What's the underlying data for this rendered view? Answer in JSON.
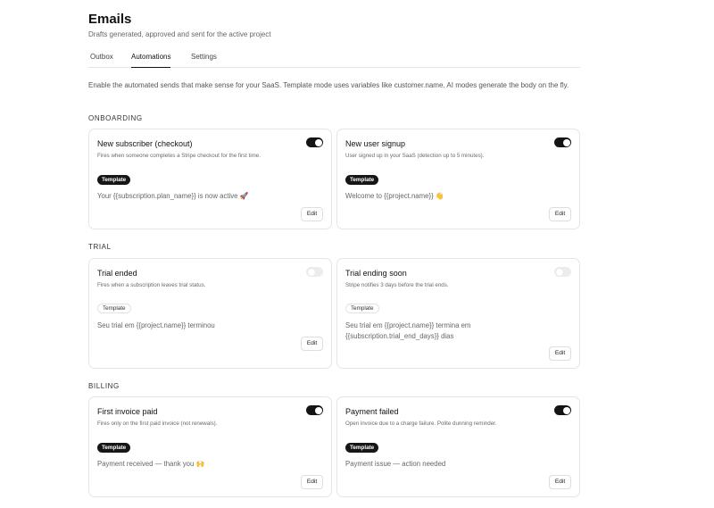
{
  "header": {
    "title": "Emails",
    "subtitle": "Drafts generated, approved and sent for the active project"
  },
  "tabs": [
    {
      "label": "Outbox",
      "active": false
    },
    {
      "label": "Automations",
      "active": true
    },
    {
      "label": "Settings",
      "active": false
    }
  ],
  "intro": "Enable the automated sends that make sense for your SaaS. Template mode uses variables like customer.name. AI modes generate the body on the fly.",
  "sections": {
    "onboarding": {
      "label": "ONBOARDING",
      "cards": [
        {
          "title": "New subscriber (checkout)",
          "description": "Fires when someone completes a Stripe checkout for the first time.",
          "mode": "Template",
          "enabled": true,
          "body": "Your {{subscription.plan_name}} is now active 🚀",
          "edit_label": "Edit"
        },
        {
          "title": "New user signup",
          "description": "User signed up in your SaaS (detection up to 5 minutes).",
          "mode": "Template",
          "enabled": true,
          "body": "Welcome to {{project.name}} 👋",
          "edit_label": "Edit"
        }
      ]
    },
    "trial": {
      "label": "TRIAL",
      "cards": [
        {
          "title": "Trial ended",
          "description": "Fires when a subscription leaves trial status.",
          "mode": "Template",
          "enabled": false,
          "body": "Seu trial em {{project.name}} terminou",
          "edit_label": "Edit"
        },
        {
          "title": "Trial ending soon",
          "description": "Stripe notifies 3 days before the trial ends.",
          "mode": "Template",
          "enabled": false,
          "body": "Seu trial em {{project.name}} termina em {{subscription.trial_end_days}} dias",
          "edit_label": "Edit"
        }
      ]
    },
    "billing": {
      "label": "BILLING",
      "cards": [
        {
          "title": "First invoice paid",
          "description": "Fires only on the first paid invoice (not renewals).",
          "mode": "Template",
          "enabled": true,
          "body": "Payment received — thank you 🙌",
          "edit_label": "Edit"
        },
        {
          "title": "Payment failed",
          "description": "Open invoice due to a charge failure. Polite dunning reminder.",
          "mode": "Template",
          "enabled": true,
          "body": "Payment issue — action needed",
          "edit_label": "Edit"
        }
      ]
    }
  },
  "colors": {
    "toggle_on": "#141414",
    "toggle_off": "#ececec",
    "badge_enabled": "#161616"
  }
}
